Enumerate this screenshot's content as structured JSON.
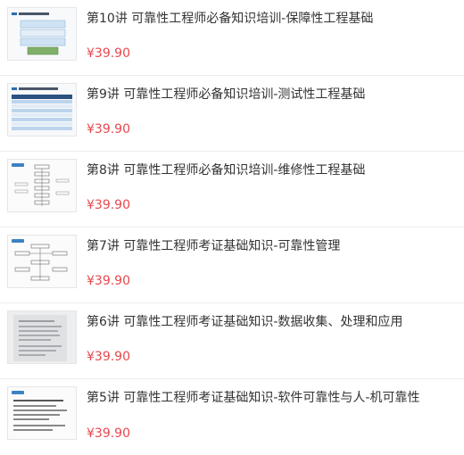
{
  "courses": [
    {
      "title": "第10讲 可靠性工程师必备知识培训-保障性工程基础",
      "price": "¥39.90",
      "thumb_icon": "slide-thumbnail-icon",
      "thumb_style": "table"
    },
    {
      "title": "第9讲 可靠性工程师必备知识培训-测试性工程基础",
      "price": "¥39.90",
      "thumb_icon": "slide-thumbnail-icon",
      "thumb_style": "table-dark"
    },
    {
      "title": "第8讲 可靠性工程师必备知识培训-维修性工程基础",
      "price": "¥39.90",
      "thumb_icon": "flowchart-thumbnail-icon",
      "thumb_style": "flow"
    },
    {
      "title": "第7讲 可靠性工程师考证基础知识-可靠性管理",
      "price": "¥39.90",
      "thumb_icon": "flowchart-thumbnail-icon",
      "thumb_style": "flow"
    },
    {
      "title": "第6讲 可靠性工程师考证基础知识-数据收集、处理和应用",
      "price": "¥39.90",
      "thumb_icon": "document-scan-thumbnail-icon",
      "thumb_style": "scan"
    },
    {
      "title": "第5讲 可靠性工程师考证基础知识-软件可靠性与人-机可靠性",
      "price": "¥39.90",
      "thumb_icon": "slide-thumbnail-icon",
      "thumb_style": "text"
    }
  ],
  "colors": {
    "price": "#e8484d",
    "title": "#333333",
    "divider": "#ededed"
  }
}
